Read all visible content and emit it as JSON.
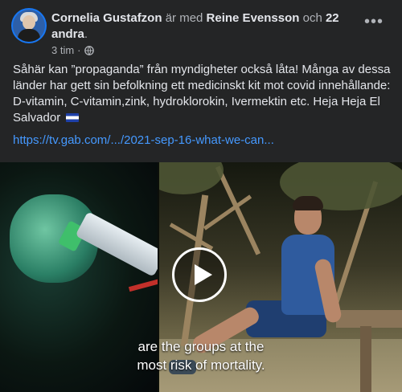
{
  "post": {
    "author": "Cornelia Gustafzon",
    "with_text": "är med",
    "tagged_person": "Reine Evensson",
    "and_text": "och",
    "others": "22 andra",
    "time": "3 tim",
    "privacy_icon": "globe-icon",
    "more_icon": "more-icon",
    "body": "Såhär kan ”propaganda” från myndigheter också låta! Många av dessa länder har gett sin befolkning ett medicinskt kit mot covid innehållande: D-vitamin, C-vitamin,zink, hydroklorokin, Ivermektin etc. Heja Heja El Salvador",
    "link": "https://tv.gab.com/.../2021-sep-16-what-we-can..."
  },
  "video": {
    "caption_line1": "are the groups at the",
    "caption_line2": "most risk of mortality.",
    "play_icon": "play-icon"
  },
  "colors": {
    "background": "#242526",
    "link": "#4599ff",
    "text": "#e4e6eb",
    "muted": "#b0b3b8"
  }
}
